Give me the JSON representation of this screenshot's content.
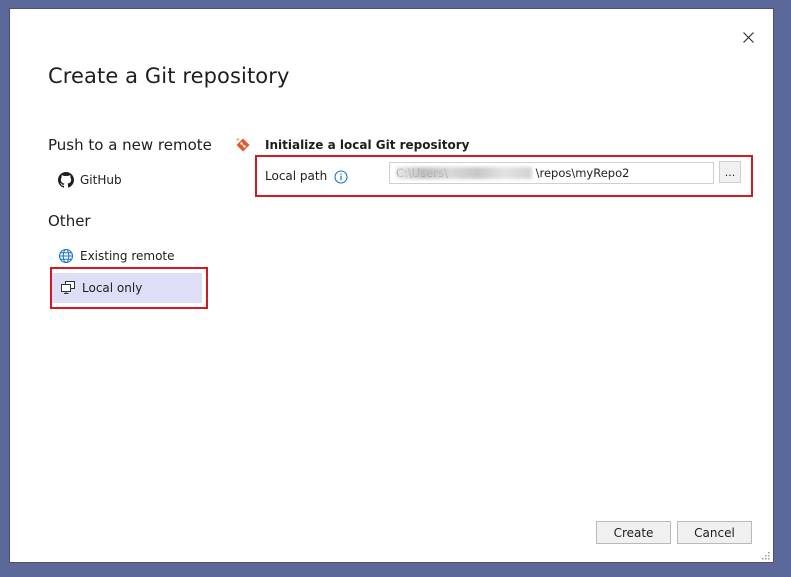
{
  "dialog": {
    "title": "Create a Git repository",
    "close_icon": "close-icon"
  },
  "sidebar": {
    "push_heading": "Push to a new remote",
    "push_items": [
      {
        "label": "GitHub",
        "icon": "github-icon"
      }
    ],
    "other_heading": "Other",
    "other_items": [
      {
        "label": "Existing remote",
        "icon": "globe-icon"
      },
      {
        "label": "Local only",
        "icon": "local-computer-icon",
        "selected": true
      }
    ]
  },
  "main": {
    "section_title": "Initialize a local Git repository",
    "section_icon": "git-repository-icon",
    "local_path": {
      "label": "Local path",
      "info_icon": "info-icon",
      "value": "C:\\Users\\                        \\repos\\myRepo2",
      "browse_label": "..."
    }
  },
  "footer": {
    "create_label": "Create",
    "cancel_label": "Cancel"
  },
  "colors": {
    "backdrop": "#5b689a",
    "selected_bg": "#dcdff6",
    "highlight_box": "#d11a24",
    "info_blue": "#1a73c8",
    "git_orange": "#e05a2a"
  }
}
